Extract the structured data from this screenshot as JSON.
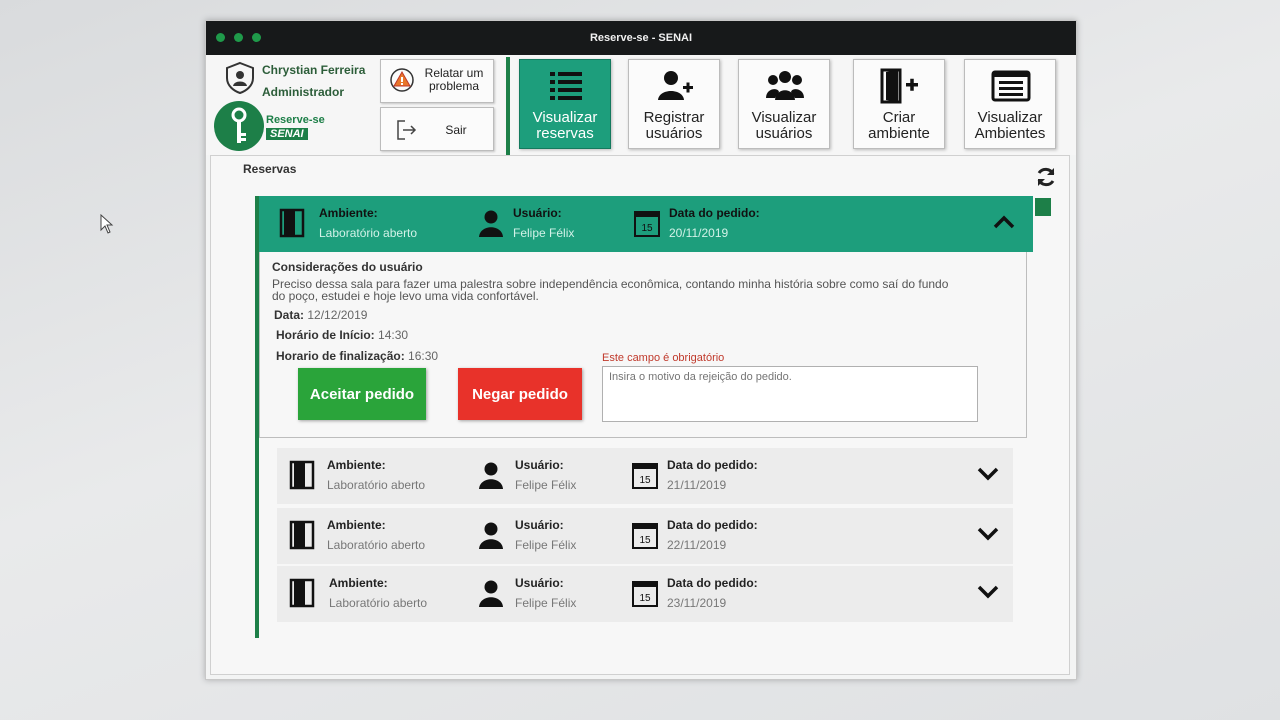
{
  "window": {
    "title": "Reserve-se - SENAI"
  },
  "user": {
    "name": "Chrystian Ferreira",
    "role": "Administrador"
  },
  "logo": {
    "line1": "Reserve-se",
    "line2": "SENAI"
  },
  "actions": {
    "report_label": "Relatar um problema",
    "logout_label": "Sair"
  },
  "nav": [
    {
      "label": "Visualizar reservas",
      "icon": "list-icon",
      "active": true
    },
    {
      "label": "Registrar usuários",
      "icon": "add-user-icon",
      "active": false
    },
    {
      "label": "Visualizar usuários",
      "icon": "users-icon",
      "active": false
    },
    {
      "label": "Criar ambiente",
      "icon": "add-door-icon",
      "active": false
    },
    {
      "label": "Visualizar Ambientes",
      "icon": "browser-list-icon",
      "active": false
    }
  ],
  "section": {
    "title": "Reservas"
  },
  "labels": {
    "ambiente": "Ambiente:",
    "usuario": "Usuário:",
    "data_pedido": "Data do pedido:"
  },
  "reservations": [
    {
      "ambiente": "Laboratório aberto",
      "usuario": "Felipe Félix",
      "data_pedido": "20/11/2019",
      "expanded": true
    },
    {
      "ambiente": "Laboratório aberto",
      "usuario": "Felipe Félix",
      "data_pedido": "21/11/2019",
      "expanded": false
    },
    {
      "ambiente": "Laboratório aberto",
      "usuario": "Felipe Félix",
      "data_pedido": "22/11/2019",
      "expanded": false
    },
    {
      "ambiente": "Laboratório aberto",
      "usuario": "Felipe Félix",
      "data_pedido": "23/11/2019",
      "expanded": false
    }
  ],
  "calendar_day": "15",
  "details": {
    "title": "Considerações do usuário",
    "text": "Preciso dessa sala para fazer uma palestra sobre independência econômica, contando minha história sobre como saí do fundo do poço, estudei e hoje levo uma vida confortável.",
    "date_label": "Data:",
    "date_value": "12/12/2019",
    "start_label": "Horário de Início:",
    "start_value": "14:30",
    "end_label": "Horario de finalização:",
    "end_value": "16:30",
    "accept_label": "Aceitar pedido",
    "deny_label": "Negar pedido",
    "required_msg": "Este campo é obrigatório",
    "reason_placeholder": "Insira o motivo da rejeição do pedido."
  },
  "colors": {
    "brand": "#1d7f48",
    "active": "#1d9e7c",
    "accept": "#2aa43a",
    "deny": "#e8322a"
  }
}
